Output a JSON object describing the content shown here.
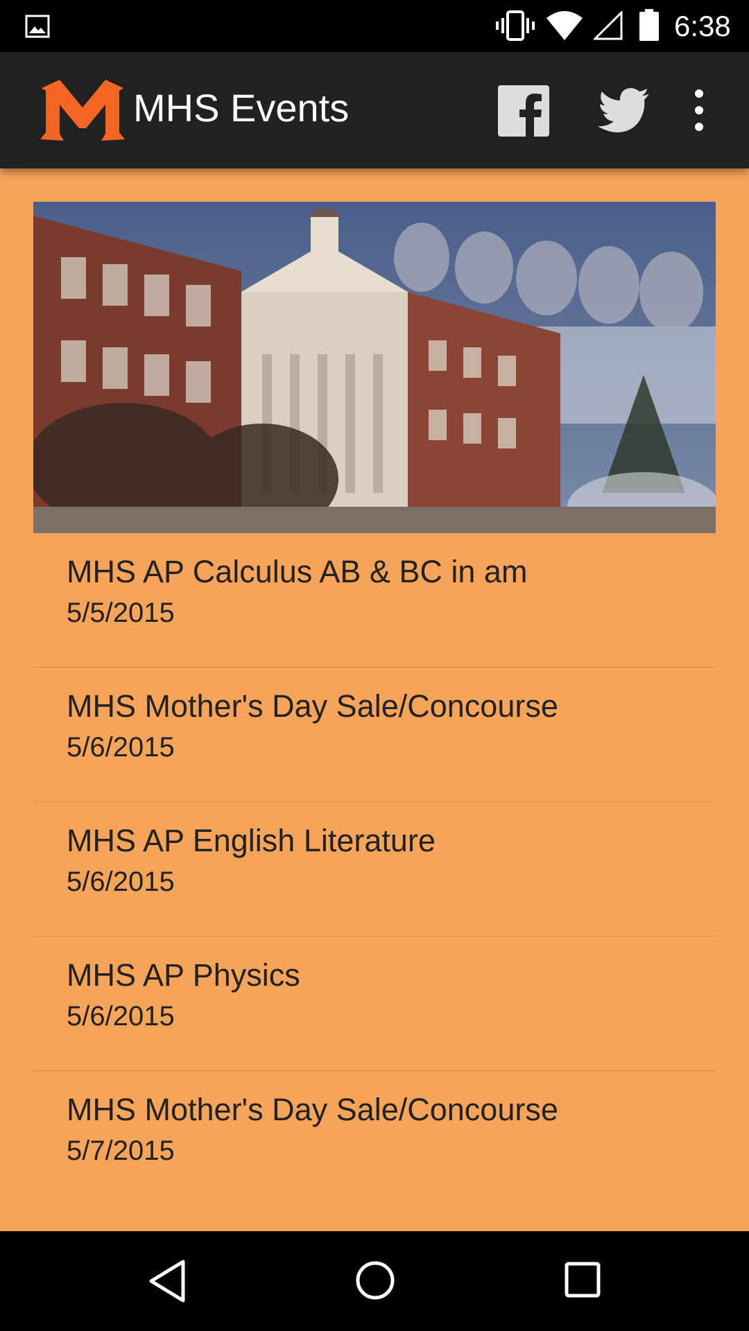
{
  "status_bar": {
    "time": "6:38",
    "icons": [
      "image-notification-icon",
      "vibrate-icon",
      "wifi-icon",
      "cell-signal-icon",
      "battery-icon"
    ]
  },
  "app_bar": {
    "logo_letter": "M",
    "title": "MHS Events",
    "actions": [
      "facebook-icon",
      "twitter-icon",
      "more-options-icon"
    ]
  },
  "colors": {
    "background": "#f6a45a",
    "app_bar": "#212121",
    "logo": "#f26522",
    "text": "#222222"
  },
  "events": [
    {
      "name": "MHS AP Calculus AB & BC in am",
      "date": "5/5/2015"
    },
    {
      "name": "MHS Mother's Day Sale/Concourse",
      "date": "5/6/2015"
    },
    {
      "name": "MHS AP English Literature",
      "date": "5/6/2015"
    },
    {
      "name": "MHS AP Physics",
      "date": "5/6/2015"
    },
    {
      "name": "MHS Mother's Day Sale/Concourse",
      "date": "5/7/2015"
    }
  ],
  "nav_bar": {
    "buttons": [
      "back-icon",
      "home-icon",
      "recents-icon"
    ]
  }
}
